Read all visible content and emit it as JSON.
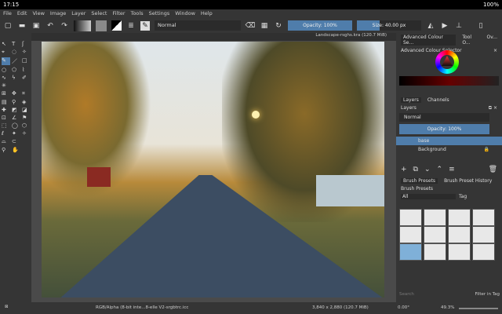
{
  "system": {
    "time": "17:15",
    "battery": "100%"
  },
  "menu": [
    "File",
    "Edit",
    "View",
    "Image",
    "Layer",
    "Select",
    "Filter",
    "Tools",
    "Settings",
    "Window",
    "Help"
  ],
  "toolbar": {
    "blend_mode": "Normal",
    "opacity": "Opacity: 100%",
    "opacity_value": 100,
    "size": "Size: 40.00 px",
    "size_fill": 0.35
  },
  "document": {
    "tab_title": "Landscape-rsghs.kra (120.7 MiB)"
  },
  "docker": {
    "top_tabs": [
      "Advanced Colour Se...",
      "Tool O...",
      "Ov..."
    ],
    "colour_selector_title": "Advanced Colour Selector",
    "layer_tabs": [
      "Layers",
      "Channels"
    ],
    "layers_title": "Layers",
    "blend_mode": "Normal",
    "opacity": "Opacity: 100%",
    "layers": [
      {
        "name": "base",
        "selected": true
      },
      {
        "name": "Background",
        "selected": false,
        "locked": true
      }
    ],
    "brush_tabs": [
      "Brush Presets",
      "Brush Preset History"
    ],
    "brush_title": "Brush Presets",
    "brush_filter": "All",
    "tag_label": "Tag",
    "search_placeholder": "Search",
    "filter_in_tag": "Filter in Tag"
  },
  "status": {
    "colour_space": "RGB/Alpha (8-bit inte...8-elle V2-srgbtrc.icc",
    "dimensions": "3,840 x 2,880 (120.7 MiB)",
    "rotation": "0.00°",
    "zoom": "49.3%"
  },
  "colors": {
    "accent": "#4f7dab",
    "panel": "#353535",
    "selected_layer": "#4f7dab"
  }
}
